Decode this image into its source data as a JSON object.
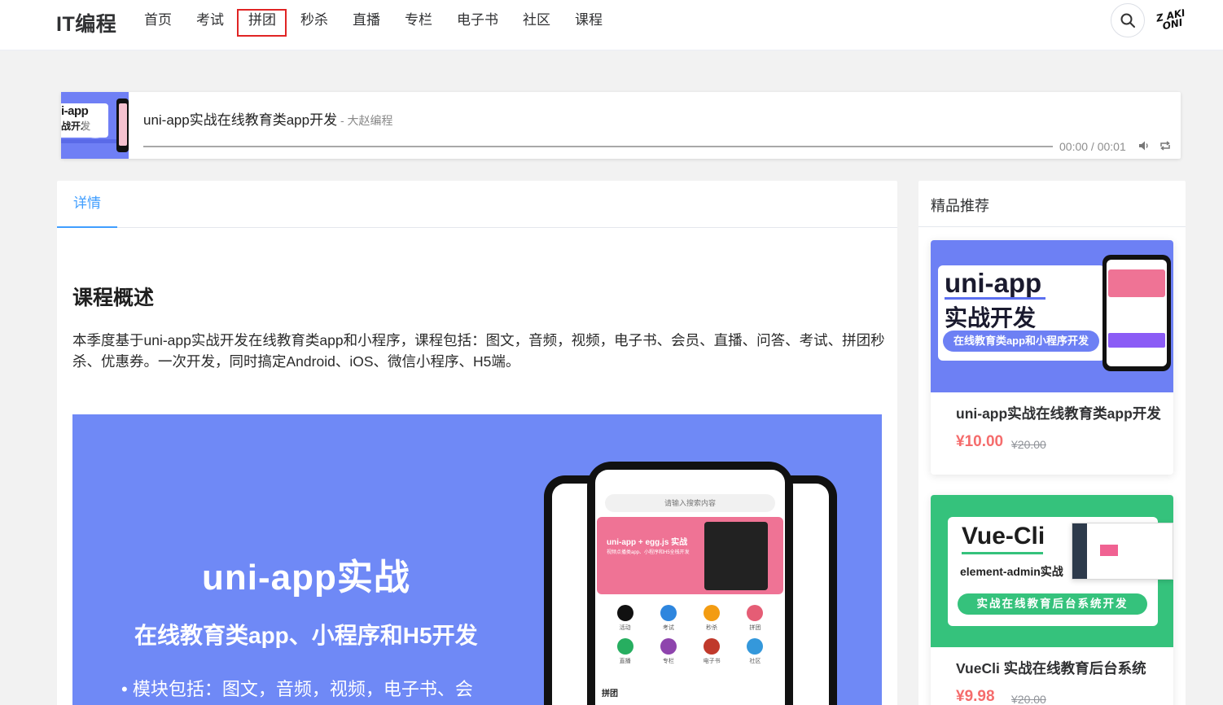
{
  "header": {
    "logo": "IT编程",
    "nav": [
      {
        "label": "首页"
      },
      {
        "label": "考试"
      },
      {
        "label": "拼团"
      },
      {
        "label": "秒杀"
      },
      {
        "label": "直播"
      },
      {
        "label": "专栏"
      },
      {
        "label": "电子书"
      },
      {
        "label": "社区"
      },
      {
        "label": "课程"
      }
    ],
    "search_icon": "search-icon",
    "avatar_text": "Z AKI ONI"
  },
  "player": {
    "cover_line1": "i-app",
    "cover_line2": "战开发",
    "title": "uni-app实战在线教育类app开发",
    "author": " - 大赵编程",
    "time": "00:00 / 00:01",
    "volume_icon": "volume-icon",
    "loop_icon": "loop-icon"
  },
  "main": {
    "tab": "详情",
    "section_title": "课程概述",
    "description": "本季度基于uni-app实战开发在线教育类app和小程序，课程包括：图文，音频，视频，电子书、会员、直播、问答、考试、拼团秒杀、优惠券。一次开发，同时搞定Android、iOS、微信小程序、H5端。",
    "banner": {
      "title": "uni-app实战",
      "subtitle": "在线教育类app、小程序和H5开发",
      "bullet": "•  模块包括：图文，音频，视频，电子书、会",
      "phone": {
        "search": "请输入搜索内容",
        "card_title": "uni-app + egg.js 实战",
        "card_sub": "视频点播类app、小程序和H5全栈开发",
        "icons": [
          "活动",
          "考试",
          "秒杀",
          "拼团",
          "直播",
          "专栏",
          "电子书",
          "社区"
        ],
        "section": "拼团"
      }
    }
  },
  "sidebar": {
    "title": "精品推荐",
    "items": [
      {
        "img_line1": "uni-app",
        "img_line2": "实战开发",
        "img_pill": "在线教育类app和小程序开发",
        "name": "uni-app实战在线教育类app开发",
        "price": "¥10.00",
        "old_price": "¥20.00"
      },
      {
        "img_line1": "Vue-Cli",
        "img_line2": "element-admin实战",
        "img_pill": "实战在线教育后台系统开发",
        "name": "VueCli 实战在线教育后台系统",
        "price": "¥9.98",
        "old_price": "¥20.00"
      }
    ]
  },
  "colors": {
    "accent": "#409eff",
    "price": "#f56c6c",
    "highlight_box": "#e02424",
    "banner_blue": "#6f89f6",
    "card_green": "#35c27c"
  }
}
